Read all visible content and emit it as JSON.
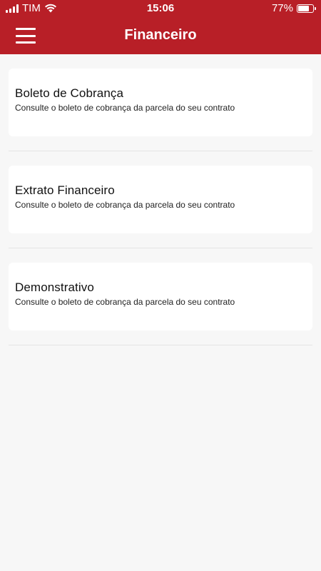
{
  "status_bar": {
    "carrier": "TIM",
    "time": "15:06",
    "battery": "77%",
    "battery_level": 0.77
  },
  "header": {
    "title": "Financeiro",
    "menu_icon": "hamburger-menu-icon"
  },
  "items": [
    {
      "title": "Boleto de Cobrança",
      "subtitle": "Consulte o boleto de cobrança da parcela do seu contrato"
    },
    {
      "title": "Extrato Financeiro",
      "subtitle": "Consulte o boleto de cobrança da parcela do seu contrato"
    },
    {
      "title": "Demonstrativo",
      "subtitle": "Consulte o boleto de cobrança da parcela do seu contrato"
    }
  ],
  "colors": {
    "header_bg": "#b81f27",
    "page_bg": "#f7f7f7",
    "card_bg": "#ffffff"
  }
}
